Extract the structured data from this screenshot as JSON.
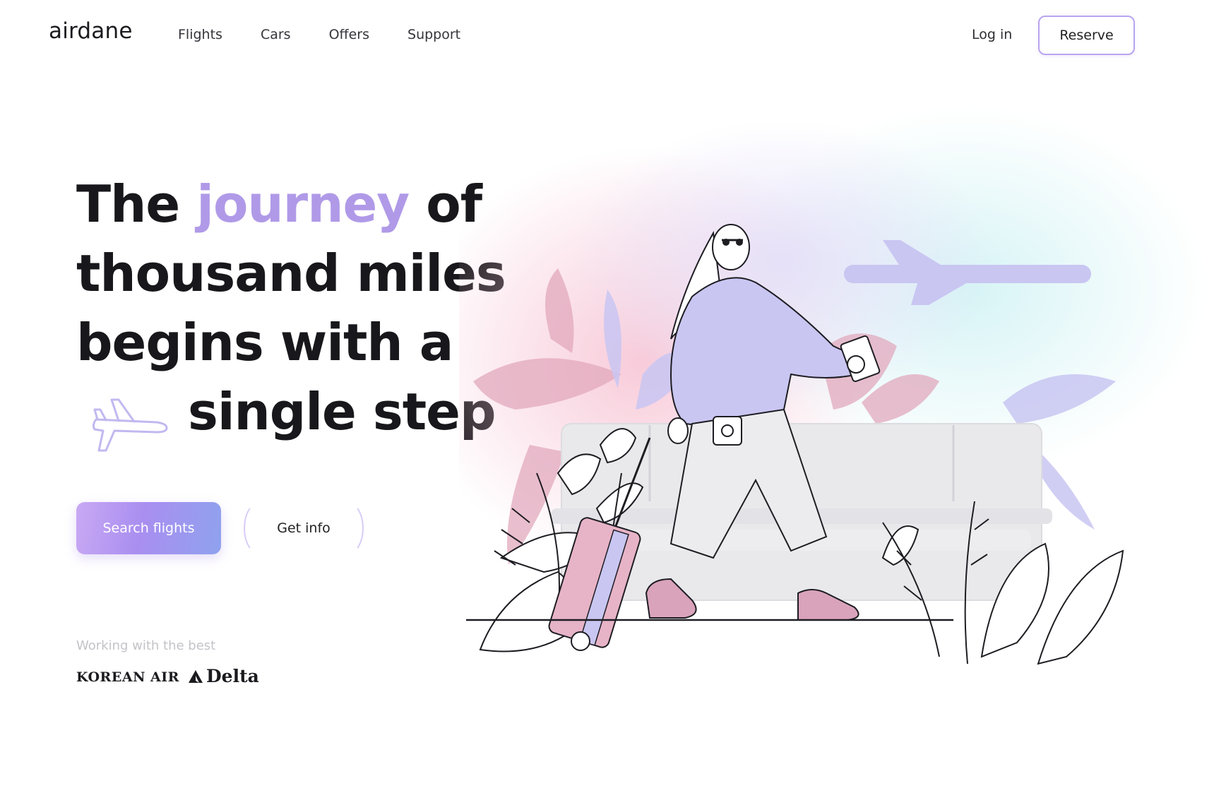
{
  "header": {
    "logo": "airdane",
    "nav": [
      "Flights",
      "Cars",
      "Offers",
      "Support"
    ],
    "login_label": "Log in",
    "reserve_label": "Reserve"
  },
  "hero": {
    "headline": {
      "line1_pre": "The",
      "line1_accent": "journey",
      "line1_post": "of",
      "line2": "thousand miles",
      "line3": "begins with a",
      "line4": "single step"
    },
    "primary_cta": "Search flights",
    "secondary_cta": "Get info"
  },
  "partners": {
    "label": "Working with the best",
    "names": [
      "KOREAN AIR",
      "Delta"
    ]
  },
  "colors": {
    "accent": "#b09ae8",
    "button_gradient_start": "#c9a9f4",
    "button_gradient_end": "#8fa2ee",
    "reserve_border": "#b9a4f0",
    "illustration_lavender": "#c9c6f2",
    "illustration_pink": "#e2a9bd"
  },
  "icons": {
    "hero_icon": "airplane-outline-icon",
    "illustration_plane": "airplane-silhouette-icon",
    "delta_logo": "triangle-icon"
  }
}
